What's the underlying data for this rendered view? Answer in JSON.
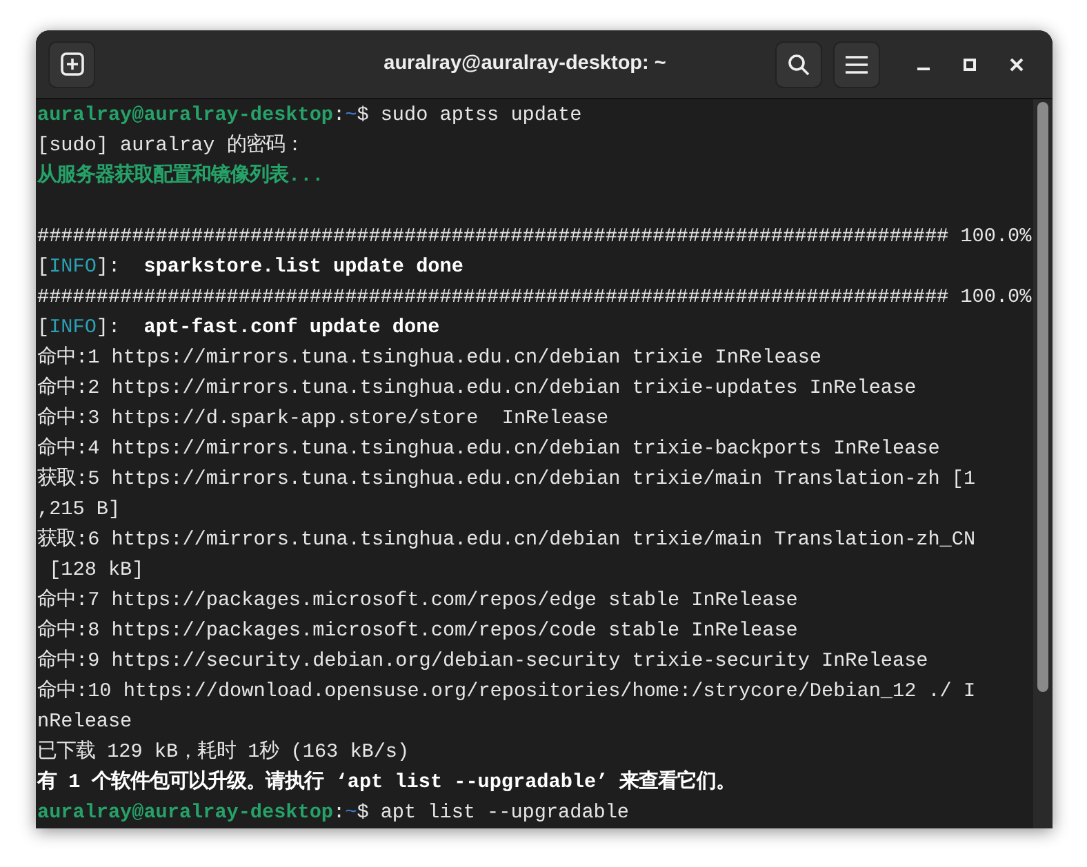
{
  "window": {
    "title": "auralray@auralray-desktop: ~"
  },
  "terminal": {
    "lines": [
      {
        "segments": [
          {
            "kind": "user",
            "text": "auralray@auralray-desktop"
          },
          {
            "kind": "plain",
            "text": ":"
          },
          {
            "kind": "path",
            "text": "~"
          },
          {
            "kind": "plain",
            "text": "$ sudo aptss update"
          }
        ]
      },
      {
        "segments": [
          {
            "kind": "plain",
            "text": "[sudo] auralray 的密码："
          }
        ]
      },
      {
        "segments": [
          {
            "kind": "green",
            "text": "从服务器获取配置和镜像列表..."
          }
        ]
      },
      {
        "kind": "blank"
      },
      {
        "segments": [
          {
            "kind": "plain",
            "text": "############################################################################# 100.0%"
          }
        ]
      },
      {
        "segments": [
          {
            "kind": "plain",
            "text": "["
          },
          {
            "kind": "info",
            "text": "INFO"
          },
          {
            "kind": "plain",
            "text": "]:  "
          },
          {
            "kind": "bold",
            "text": "sparkstore.list update done"
          }
        ]
      },
      {
        "segments": [
          {
            "kind": "plain",
            "text": "############################################################################# 100.0%"
          }
        ]
      },
      {
        "segments": [
          {
            "kind": "plain",
            "text": "["
          },
          {
            "kind": "info",
            "text": "INFO"
          },
          {
            "kind": "plain",
            "text": "]:  "
          },
          {
            "kind": "bold",
            "text": "apt-fast.conf update done"
          }
        ]
      },
      {
        "segments": [
          {
            "kind": "plain",
            "text": "命中:1 https://mirrors.tuna.tsinghua.edu.cn/debian trixie InRelease"
          }
        ]
      },
      {
        "segments": [
          {
            "kind": "plain",
            "text": "命中:2 https://mirrors.tuna.tsinghua.edu.cn/debian trixie-updates InRelease"
          }
        ]
      },
      {
        "segments": [
          {
            "kind": "plain",
            "text": "命中:3 https://d.spark-app.store/store  InRelease"
          }
        ]
      },
      {
        "segments": [
          {
            "kind": "plain",
            "text": "命中:4 https://mirrors.tuna.tsinghua.edu.cn/debian trixie-backports InRelease"
          }
        ]
      },
      {
        "segments": [
          {
            "kind": "plain",
            "text": "获取:5 https://mirrors.tuna.tsinghua.edu.cn/debian trixie/main Translation-zh [1"
          }
        ]
      },
      {
        "segments": [
          {
            "kind": "plain",
            "text": ",215 B]"
          }
        ]
      },
      {
        "segments": [
          {
            "kind": "plain",
            "text": "获取:6 https://mirrors.tuna.tsinghua.edu.cn/debian trixie/main Translation-zh_CN"
          }
        ]
      },
      {
        "segments": [
          {
            "kind": "plain",
            "text": " [128 kB]"
          }
        ]
      },
      {
        "segments": [
          {
            "kind": "plain",
            "text": "命中:7 https://packages.microsoft.com/repos/edge stable InRelease"
          }
        ]
      },
      {
        "segments": [
          {
            "kind": "plain",
            "text": "命中:8 https://packages.microsoft.com/repos/code stable InRelease"
          }
        ]
      },
      {
        "segments": [
          {
            "kind": "plain",
            "text": "命中:9 https://security.debian.org/debian-security trixie-security InRelease"
          }
        ]
      },
      {
        "segments": [
          {
            "kind": "plain",
            "text": "命中:10 https://download.opensuse.org/repositories/home:/strycore/Debian_12 ./ I"
          }
        ]
      },
      {
        "segments": [
          {
            "kind": "plain",
            "text": "nRelease"
          }
        ]
      },
      {
        "segments": [
          {
            "kind": "plain",
            "text": "已下载 129 kB，耗时 1秒 (163 kB/s)"
          }
        ]
      },
      {
        "segments": [
          {
            "kind": "bold",
            "text": "有 1 个软件包可以升级。请执行 ‘apt list --upgradable’ 来查看它们。"
          }
        ]
      },
      {
        "segments": [
          {
            "kind": "user",
            "text": "auralray@auralray-desktop"
          },
          {
            "kind": "plain",
            "text": ":"
          },
          {
            "kind": "path",
            "text": "~"
          },
          {
            "kind": "plain",
            "text": "$ apt list --upgradable"
          }
        ]
      }
    ]
  }
}
